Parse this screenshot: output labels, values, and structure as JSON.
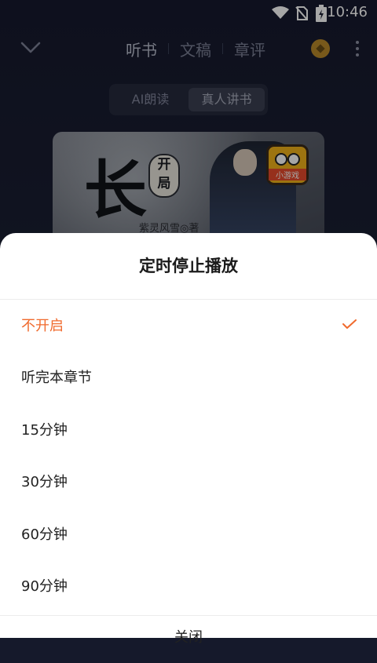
{
  "status_bar": {
    "time": "10:46"
  },
  "header": {
    "tabs": [
      {
        "label": "听书",
        "active": true
      },
      {
        "label": "文稿",
        "active": false
      },
      {
        "label": "章评",
        "active": false
      }
    ]
  },
  "mode_toggle": {
    "options": [
      {
        "label": "AI朗读",
        "active": false
      },
      {
        "label": "真人讲书",
        "active": true
      }
    ]
  },
  "cover": {
    "title_glyph": "长",
    "seal_text_top": "开",
    "seal_text_bottom": "局",
    "author": "紫灵风雪◎著",
    "badge_label": "小游戏"
  },
  "sheet": {
    "title": "定时停止播放",
    "options": [
      {
        "label": "不开启",
        "selected": true
      },
      {
        "label": "听完本章节",
        "selected": false
      },
      {
        "label": "15分钟",
        "selected": false
      },
      {
        "label": "30分钟",
        "selected": false
      },
      {
        "label": "60分钟",
        "selected": false
      },
      {
        "label": "90分钟",
        "selected": false
      }
    ],
    "close_label": "关闭"
  },
  "colors": {
    "accent": "#f06a2d",
    "background": "#1b1f33",
    "sheet": "#ffffff"
  }
}
